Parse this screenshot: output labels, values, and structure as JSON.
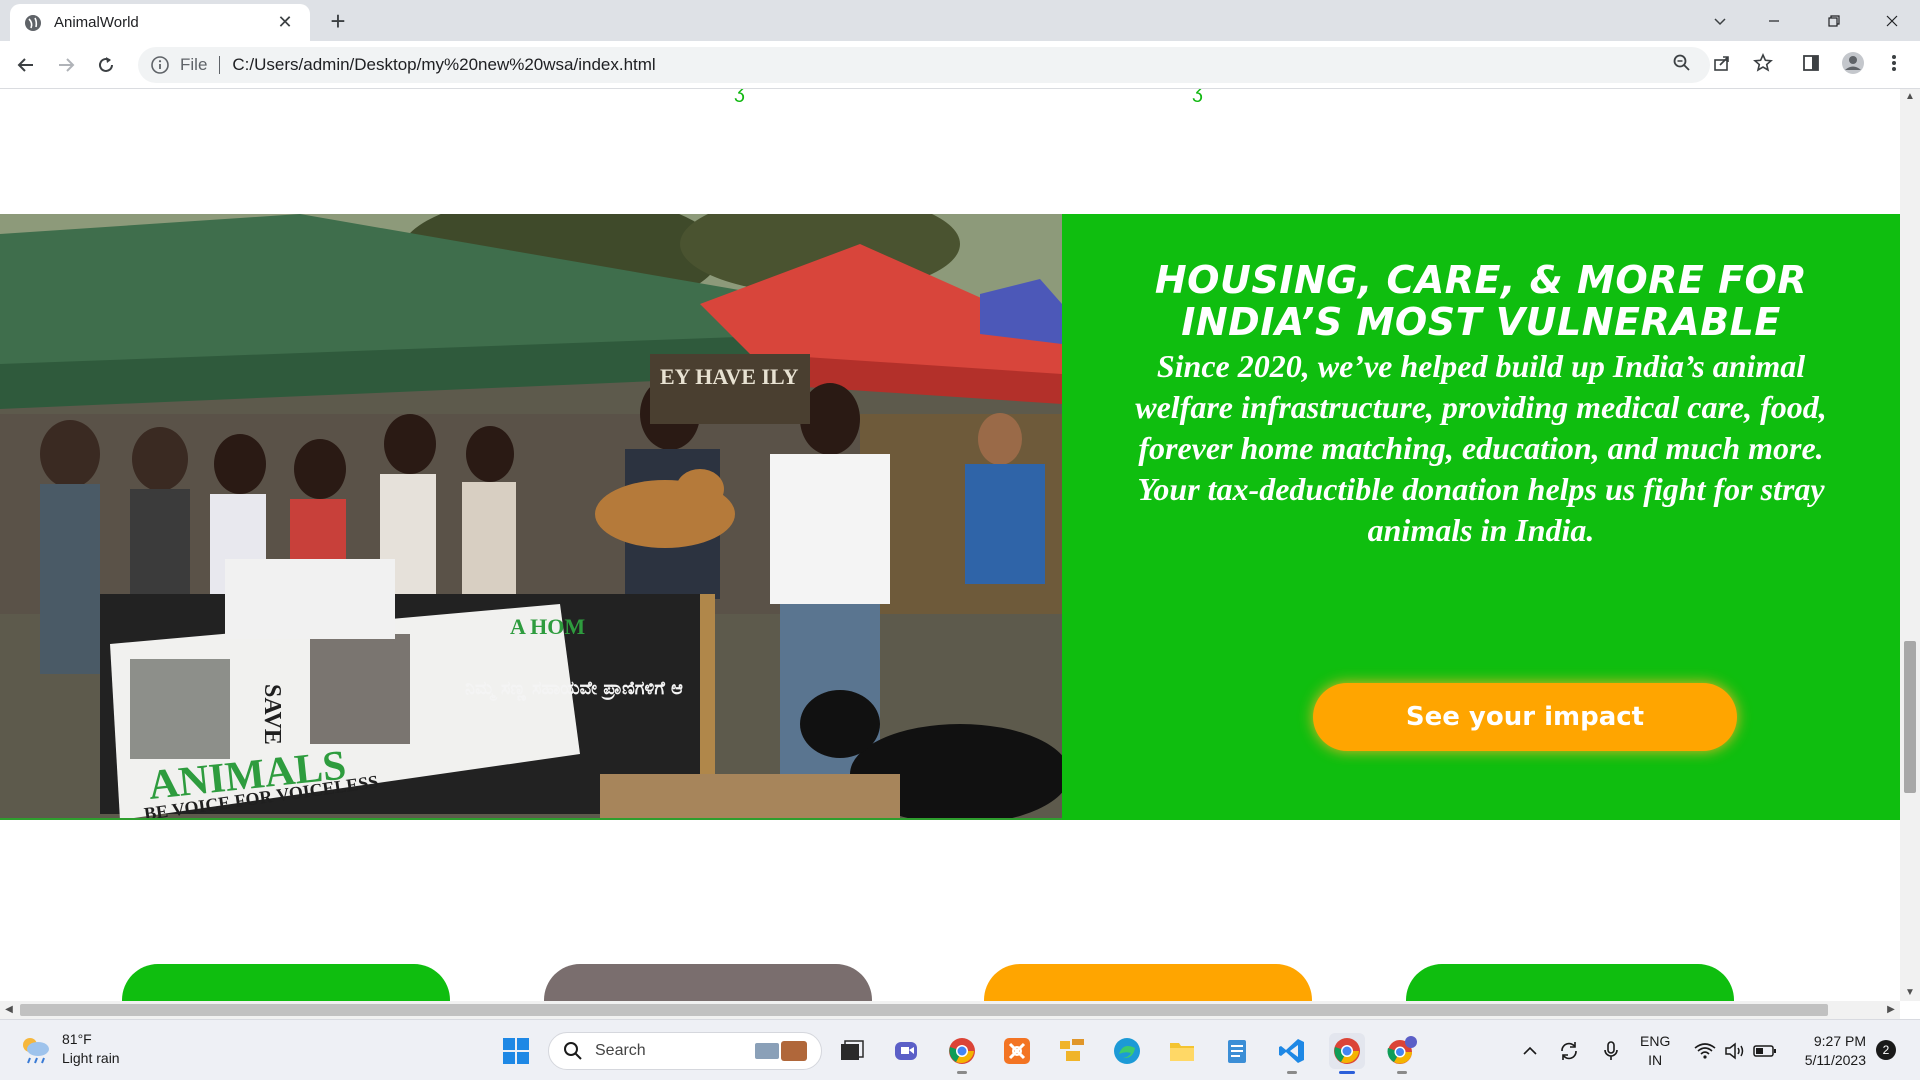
{
  "browser": {
    "tab_title": "AnimalWorld",
    "tab_close": "✕",
    "new_tab": "+",
    "scheme_label": "File",
    "url": "C:/Users/admin/Desktop/my%20new%20wsa/index.html"
  },
  "hero": {
    "heading": "HOUSING, CARE, & MORE FOR INDIA’S MOST VULNERABLE",
    "body": "Since 2020, we’ve helped build up India’s animal welfare infrastructure, providing medical care, food, forever home matching, education, and much more. Your tax-deductible donation helps us fight for stray animals in India.",
    "cta_label": "See your impact",
    "panel_color": "#0fbe0f",
    "cta_color": "#ffa500",
    "photo": {
      "banner_text_1": "SAVE",
      "banner_text_2": "ANIMALS",
      "banner_text_3": "BE VOICE FOR VOICELESS",
      "banner_text_4": "A HOM",
      "banner_kannada": "ನಿಮ್ಮ ಸಣ್ಣ ಸಹಾಯವೇ ಪ್ರಾಣಿಗಳಿಗೆ ಆ",
      "sign_text": "EY HAVE ILY"
    }
  },
  "cards": [
    {
      "color": "#0fbe0f"
    },
    {
      "color": "#7a6e6e"
    },
    {
      "color": "#ffa500"
    },
    {
      "color": "#0fbe0f"
    }
  ],
  "taskbar": {
    "weather_temp": "81°F",
    "weather_desc": "Light rain",
    "search_label": "Search",
    "lang_1": "ENG",
    "lang_2": "IN",
    "time": "9:27 PM",
    "date": "5/11/2023",
    "notification_count": "2"
  }
}
